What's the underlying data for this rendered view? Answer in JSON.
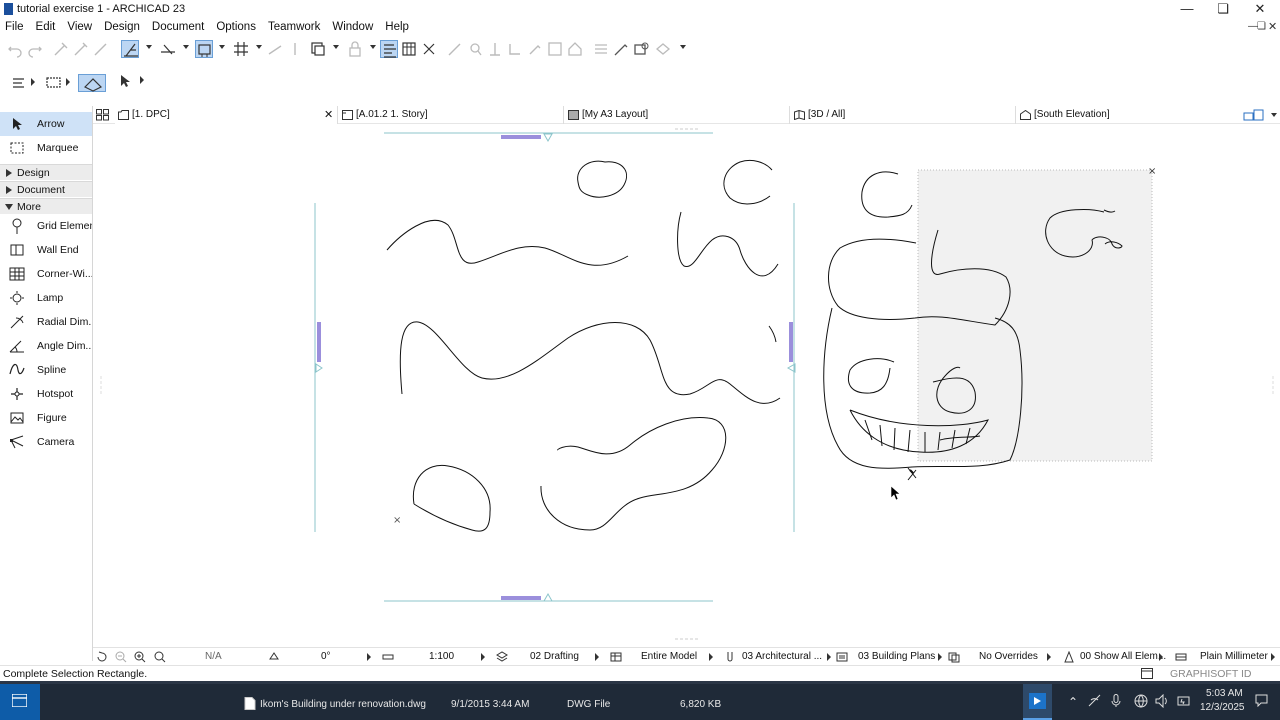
{
  "window": {
    "title": "tutorial exercise 1 - ARCHICAD 23"
  },
  "menu": [
    "File",
    "Edit",
    "View",
    "Design",
    "Document",
    "Options",
    "Teamwork",
    "Window",
    "Help"
  ],
  "toolbox": {
    "selection_tools": [
      {
        "label": "Arrow",
        "icon": "arrow-icon",
        "selected": true
      },
      {
        "label": "Marquee",
        "icon": "marquee-icon",
        "selected": false
      }
    ],
    "sections": [
      "Design",
      "Document",
      "More"
    ],
    "more_tools": [
      {
        "label": "Grid Element",
        "icon": "grid-element-icon"
      },
      {
        "label": "Wall End",
        "icon": "wall-end-icon"
      },
      {
        "label": "Corner-Wi...",
        "icon": "corner-window-icon"
      },
      {
        "label": "Lamp",
        "icon": "lamp-icon"
      },
      {
        "label": "Radial Dim...",
        "icon": "radial-dimension-icon"
      },
      {
        "label": "Angle Dim...",
        "icon": "angle-dimension-icon"
      },
      {
        "label": "Spline",
        "icon": "spline-icon"
      },
      {
        "label": "Hotspot",
        "icon": "hotspot-icon"
      },
      {
        "label": "Figure",
        "icon": "figure-icon"
      },
      {
        "label": "Camera",
        "icon": "camera-icon"
      }
    ]
  },
  "tabs": [
    {
      "label": "[1. DPC]",
      "closable": true,
      "active": true
    },
    {
      "label": "[A.01.2 1. Story]",
      "active": false
    },
    {
      "label": "[My A3 Layout]",
      "active": false
    },
    {
      "label": "[3D / All]",
      "active": false
    },
    {
      "label": "[South Elevation]",
      "active": false
    }
  ],
  "statusbar": {
    "coord": "N/A",
    "angle": "0°",
    "scale": "1:100",
    "layer_combo": "02 Drafting",
    "model_view": "Entire Model",
    "pen_set": "03 Architectural ...",
    "renovation": "03 Building Plans",
    "graphic_override": "No Overrides",
    "structure": "00 Show All Elem...",
    "dimension": "Plain Millimeter"
  },
  "hint": "Complete Selection Rectangle.",
  "brand": "GRAPHISOFT ID",
  "taskbar": {
    "file_row_top": "Ikom's Building under renovation.dwg",
    "file_date": "9/1/2015 3:44 AM",
    "file_type": "DWG File",
    "file_size": "6,820 KB",
    "clock_time": "5:03 AM",
    "clock_date": "12/3/2025"
  },
  "colors": {
    "accent": "#0078d7",
    "selection": "#cfe2f7",
    "guide": "#7ab6bd",
    "handle": "#9b8fdc"
  }
}
